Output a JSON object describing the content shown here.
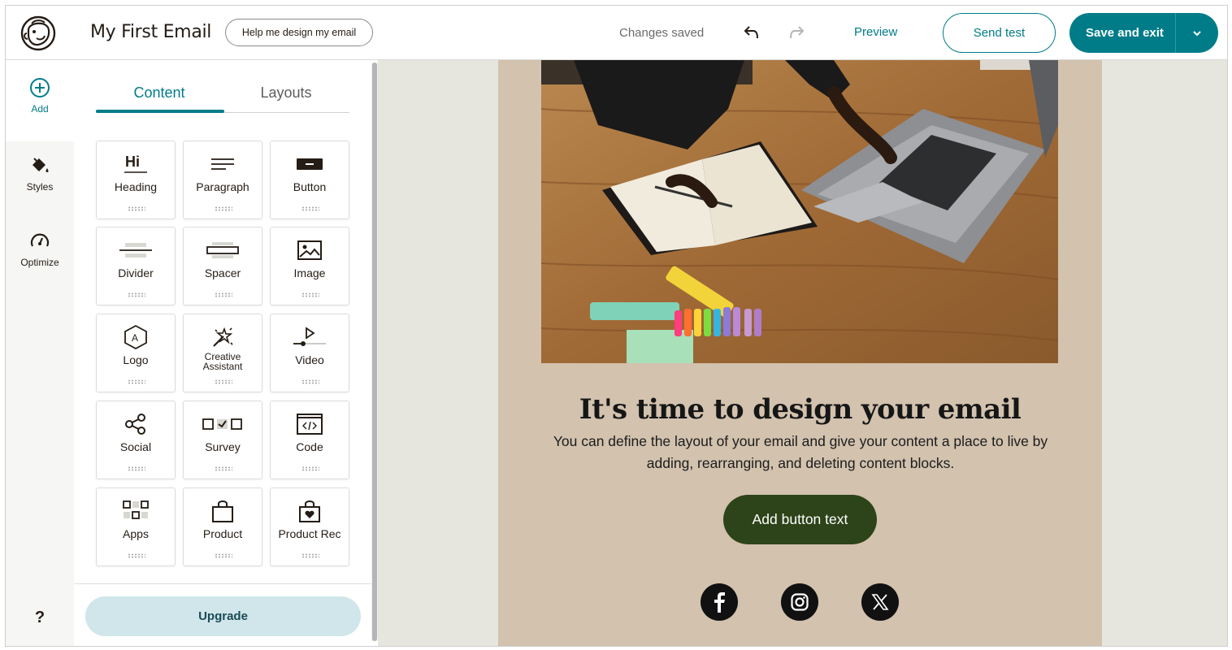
{
  "header": {
    "title": "My First Email",
    "help_label": "Help me design my email",
    "status": "Changes saved",
    "preview_label": "Preview",
    "send_test_label": "Send test",
    "save_exit_label": "Save and exit"
  },
  "rail": {
    "add": "Add",
    "styles": "Styles",
    "optimize": "Optimize",
    "help": "?"
  },
  "panel": {
    "tabs": [
      "Content",
      "Layouts"
    ],
    "blocks": [
      {
        "label": "Heading",
        "icon": "heading-icon"
      },
      {
        "label": "Paragraph",
        "icon": "paragraph-icon"
      },
      {
        "label": "Button",
        "icon": "button-icon"
      },
      {
        "label": "Divider",
        "icon": "divider-icon"
      },
      {
        "label": "Spacer",
        "icon": "spacer-icon"
      },
      {
        "label": "Image",
        "icon": "image-icon"
      },
      {
        "label": "Logo",
        "icon": "logo-icon"
      },
      {
        "label": "Creative Assistant",
        "icon": "creative-assistant-icon"
      },
      {
        "label": "Video",
        "icon": "video-icon"
      },
      {
        "label": "Social",
        "icon": "social-icon"
      },
      {
        "label": "Survey",
        "icon": "survey-icon"
      },
      {
        "label": "Code",
        "icon": "code-icon"
      },
      {
        "label": "Apps",
        "icon": "apps-icon"
      },
      {
        "label": "Product",
        "icon": "product-icon"
      },
      {
        "label": "Product Rec",
        "icon": "product-rec-icon"
      }
    ],
    "upgrade_label": "Upgrade",
    "heading_icon_text": "Hi",
    "logo_icon_text": "A"
  },
  "email": {
    "headline": "It's time to design your email",
    "body": "You can define the layout of your email and give your content a place to live by adding, rearranging, and deleting content blocks.",
    "cta_label": "Add button text",
    "social": [
      "facebook-icon",
      "instagram-icon",
      "x-icon"
    ]
  },
  "colors": {
    "accent": "#007c89",
    "email_background": "#d2c2ae",
    "canvas_background": "#e6e6df",
    "cta_background": "#2d4319",
    "upgrade_background": "#d0e6ea"
  }
}
